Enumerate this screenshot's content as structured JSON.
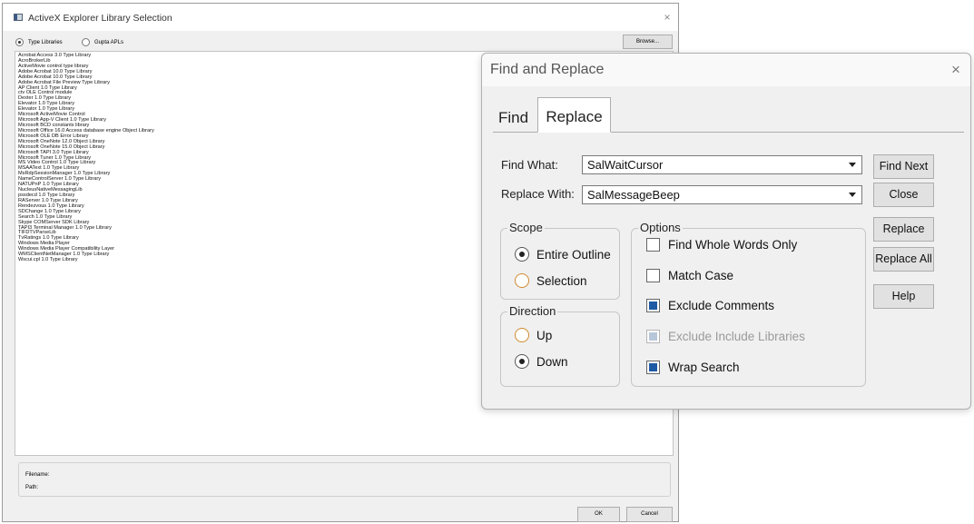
{
  "activex": {
    "title": "ActiveX Explorer Library Selection",
    "close_glyph": "×",
    "radio_type_libraries": "Type Libraries",
    "radio_gupta_apls": "Gupta APLs",
    "browse_label": "Browse...",
    "libraries": [
      "Acrobat Access 3.0 Type Library",
      "AcroBrokerLib",
      "ActiveMovie control type library",
      "Adobe Acrobat 10.0 Type Library",
      "Adobe Acrobat 10.0 Type Library",
      "Adobe Acrobat File Preview Type Library",
      "AP Client 1.0 Type Library",
      "ctv OLE Control module",
      "Dexter 1.0 Type Library",
      "Elevator 1.0 Type Library",
      "Elevator 1.0 Type Library",
      "Microsoft ActiveMovie Control",
      "Microsoft App-V Client 1.0 Type Library",
      "Microsoft BCD constants library",
      "Microsoft Office 16.0 Access database engine Object Library",
      "Microsoft OLE DB Error Library",
      "Microsoft OneNote 12.0 Object Library",
      "Microsoft OneNote 15.0 Object Library",
      "Microsoft TAPI 3.0 Type Library",
      "Microsoft Tuner 1.0 Type Library",
      "MS Video Control 1.0 Type Library",
      "MSAAText 1.0 Type Library",
      "MsRdpSessionManager 1.0 Type Library",
      "NameControlServer 1.0 Type Library",
      "NATUPnP 1.0 Type Library",
      "NucleusNativeMessagingLib",
      "pssdecd 1.0 Type Library",
      "RAServer 1.0 Type Library",
      "Rendezvous 1.0 Type Library",
      "SDChange 1.0 Type Library",
      "Search 1.0 Type Library",
      "Skype COMServer SDK Library",
      "TAPI3 Terminal Manager 1.0 Type Library",
      "TIFDTVParseLib",
      "TvRatings 1.0 Type Library",
      "Windows Media Player",
      "Windows Media Player Compatibility Layer",
      "WMSClientNetManager 1.0 Type Library",
      "Wscui.cpl 1.0 Type Library"
    ],
    "filename_label": "Filename:",
    "path_label": "Path:",
    "ok_label": "OK",
    "cancel_label": "Cancel"
  },
  "find_replace": {
    "title": "Find and Replace",
    "close_glyph": "×",
    "tabs": {
      "find": "Find",
      "replace": "Replace"
    },
    "find_what_label": "Find What:",
    "find_what_value": "SalWaitCursor",
    "replace_with_label": "Replace With:",
    "replace_with_value": "SalMessageBeep",
    "buttons": {
      "find_next": "Find Next",
      "close": "Close",
      "replace": "Replace",
      "replace_all": "Replace All",
      "help": "Help"
    },
    "scope": {
      "title": "Scope",
      "entire_outline": "Entire Outline",
      "selection": "Selection",
      "selected": "entire_outline"
    },
    "direction": {
      "title": "Direction",
      "up": "Up",
      "down": "Down",
      "selected": "down"
    },
    "options": {
      "title": "Options",
      "find_whole_words_only": "Find Whole Words Only",
      "match_case": "Match Case",
      "exclude_comments": "Exclude Comments",
      "exclude_include_libraries": "Exclude Include Libraries",
      "wrap_search": "Wrap Search"
    }
  },
  "colors": {
    "check_fill": "#1f5aa5",
    "radio_unselected_border": "#d08a30",
    "dialog_bg": "#f0f0f0"
  }
}
